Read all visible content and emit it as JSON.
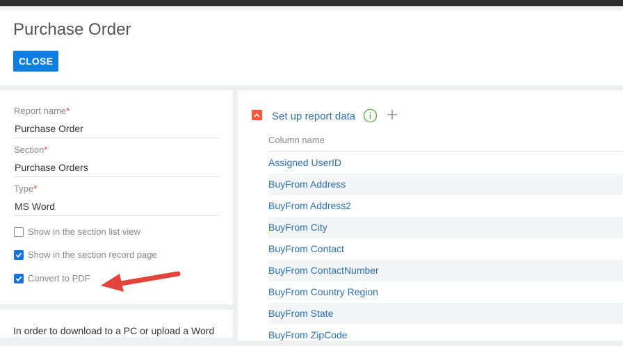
{
  "page": {
    "title": "Purchase Order",
    "close_label": "CLOSE"
  },
  "form": {
    "report_name": {
      "label": "Report name",
      "required_mark": "*",
      "value": "Purchase Order"
    },
    "section": {
      "label": "Section",
      "required_mark": "*",
      "value": "Purchase Orders"
    },
    "type": {
      "label": "Type",
      "required_mark": "*",
      "value": "MS Word"
    },
    "checkboxes": [
      {
        "label": "Show in the section list view",
        "checked": false
      },
      {
        "label": "Show in the section record page",
        "checked": true
      },
      {
        "label": "Convert to PDF",
        "checked": true
      }
    ],
    "info_text": "In order to download to a PC or upload a Word"
  },
  "report_data": {
    "title": "Set up report data",
    "column_header": "Column name",
    "columns": [
      "Assigned UserID",
      "BuyFrom Address",
      "BuyFrom Address2",
      "BuyFrom City",
      "BuyFrom Contact",
      "BuyFrom ContactNumber",
      "BuyFrom Country Region",
      "BuyFrom State",
      "BuyFrom ZipCode"
    ]
  },
  "colors": {
    "accent": "#0e7fe1",
    "link": "#2a6fb5",
    "required": "#e53b2c",
    "collapse": "#f05a3c",
    "info": "#6ab04c",
    "annotation_arrow": "#e0443a"
  },
  "icons": [
    "collapse-icon",
    "info-icon",
    "plus-icon",
    "check-icon",
    "annotation-arrow"
  ]
}
